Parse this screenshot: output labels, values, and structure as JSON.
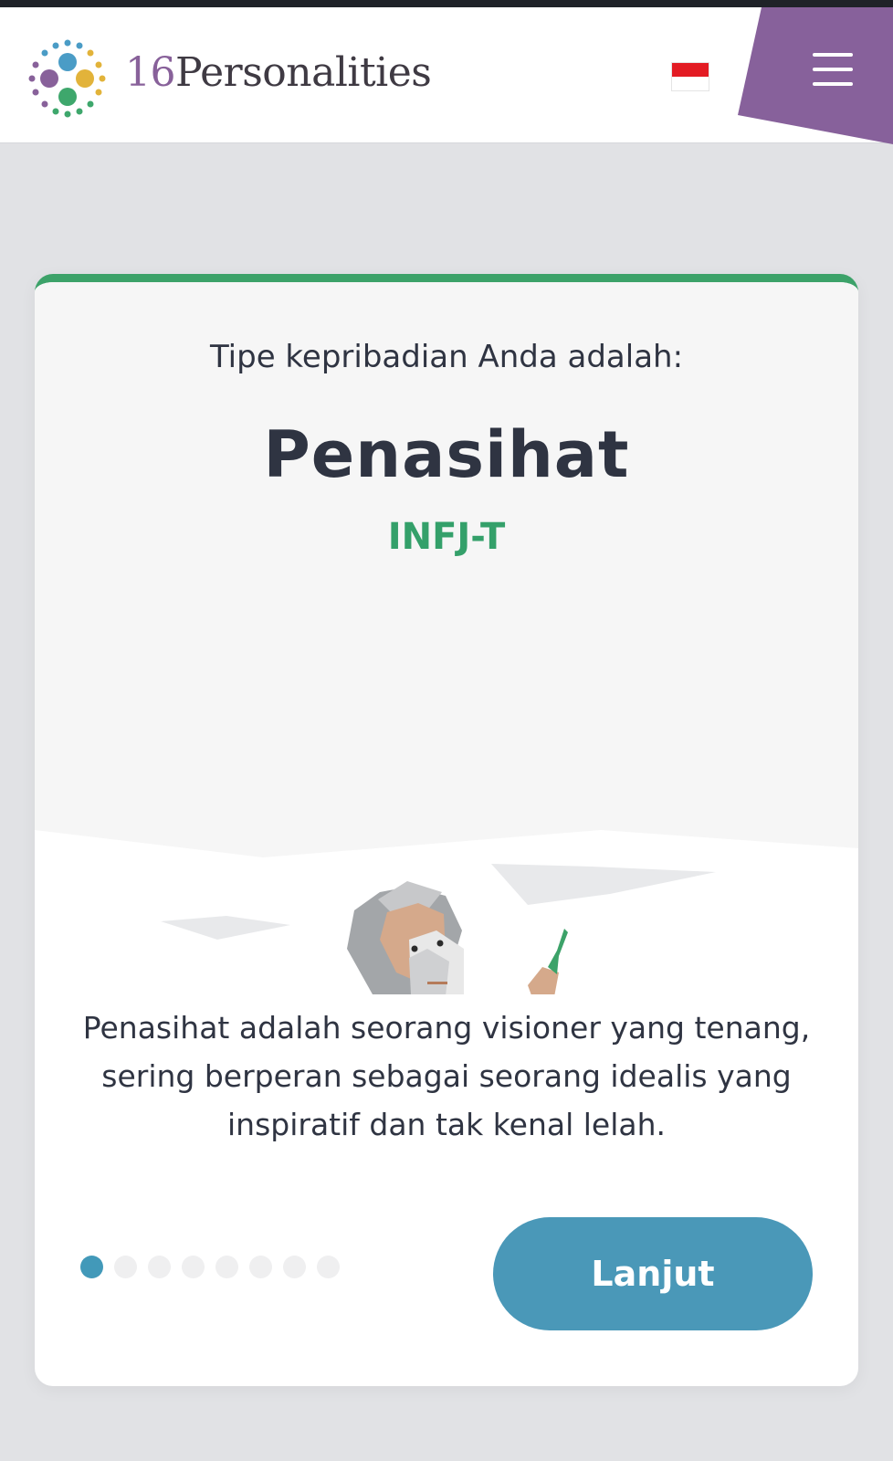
{
  "header": {
    "logo_number": "16",
    "logo_word": "Personalities",
    "language_flag": "indonesia-flag-icon",
    "menu_icon": "hamburger-menu-icon"
  },
  "colors": {
    "brand_purple": "#88619a",
    "accent_green": "#3ca269",
    "button_blue": "#4a98b8",
    "text_dark": "#2f3442"
  },
  "result": {
    "intro": "Tipe kepribadian Anda adalah:",
    "type_name": "Penasihat",
    "type_code": "INFJ-T",
    "illustration": "advocate-wizard-illustration",
    "description": "Penasihat adalah seorang visioner yang tenang, sering berperan sebagai seorang idealis yang inspiratif dan tak kenal lelah."
  },
  "pagination": {
    "total": 8,
    "current": 1
  },
  "next_button": {
    "label": "Lanjut"
  }
}
